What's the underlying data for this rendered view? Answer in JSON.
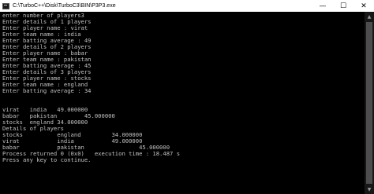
{
  "window": {
    "title": "C:\\TurboC++\\Disk\\TurboC3\\BIN\\P3P3.exe",
    "app_icon": "console-app-icon",
    "controls": {
      "minimize": "—",
      "maximize": "☐",
      "close": "✕"
    }
  },
  "terminal": {
    "lines": [
      "enter number of players3",
      "Enter details of 1 players",
      "Enter player name : virat",
      "Enter team name : india",
      "Enter batting average : 49",
      "Enter details of 2 players",
      "Enter player name : babar",
      "Enter team name : pakistan",
      "Enter batting average : 45",
      "Enter details of 3 players",
      "Enter player name : stocks",
      "Enter team name : england",
      "Enter batting average : 34",
      "",
      "",
      "virat   india   49.000000",
      "babar   pakistan        45.000000",
      "stocks  england 34.000000",
      "Details of players",
      "stocks          england         34.000000",
      "virat           india           49.000000",
      "babar           pakistan                45.000000",
      "Process returned 0 (0x0)   execution time : 18.487 s",
      "Press any key to continue."
    ]
  },
  "scrollbar": {
    "up_arrow": "▲",
    "down_arrow": "▼"
  }
}
